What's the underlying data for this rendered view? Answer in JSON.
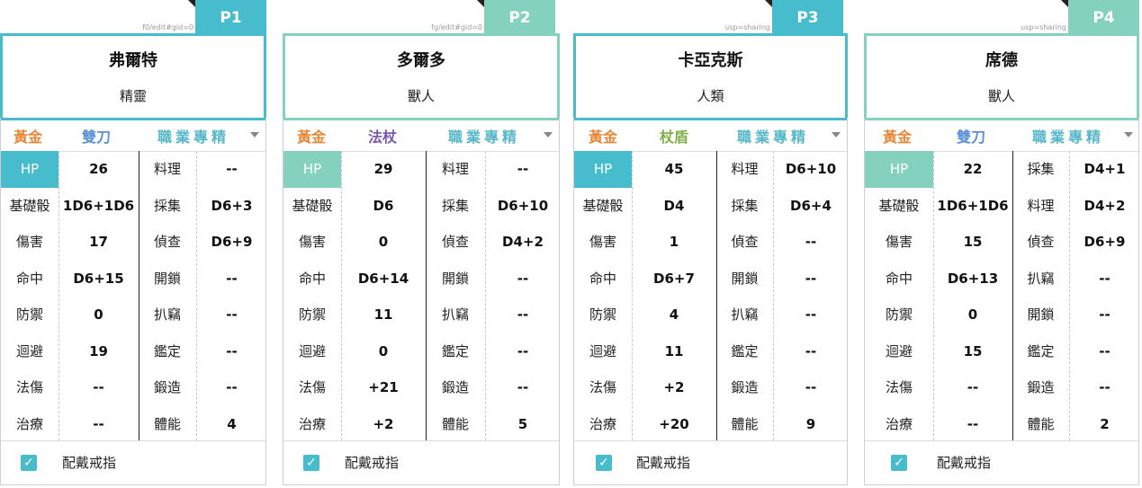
{
  "colors": {
    "teal": "#47bccd",
    "mint": "#84d1be",
    "gold": "#e8883a",
    "weapon_blue": "#5b8fd6",
    "weapon_purple": "#7b5bb0",
    "weapon_green": "#7fb04a"
  },
  "ring_label": "配戴戒指",
  "gold_label": "黃金",
  "prof_label": "職業專精",
  "stat_labels": [
    "HP",
    "基礎骰",
    "傷害",
    "命中",
    "防禦",
    "迴避",
    "法傷",
    "治療"
  ],
  "players": [
    {
      "tab": "P1",
      "url_text": "f0/edit#gid=0",
      "name": "弗爾特",
      "race": "精靈",
      "weapon": "雙刀",
      "stats": [
        "26",
        "1D6+1D6",
        "17",
        "D6+15",
        "0",
        "19",
        "--",
        "--"
      ],
      "skills": [
        [
          "料理",
          "--"
        ],
        [
          "採集",
          "D6+3"
        ],
        [
          "偵查",
          "D6+9"
        ],
        [
          "開鎖",
          "--"
        ],
        [
          "扒竊",
          "--"
        ],
        [
          "鑑定",
          "--"
        ],
        [
          "鍛造",
          "--"
        ],
        [
          "體能",
          "4"
        ]
      ],
      "ring_checked": true
    },
    {
      "tab": "P2",
      "url_text": "fg/edit#gid=0",
      "name": "多爾多",
      "race": "獸人",
      "weapon": "法杖",
      "stats": [
        "29",
        "D6",
        "0",
        "D6+14",
        "11",
        "0",
        "+21",
        "+2"
      ],
      "skills": [
        [
          "料理",
          "--"
        ],
        [
          "採集",
          "D6+10"
        ],
        [
          "偵查",
          "D4+2"
        ],
        [
          "開鎖",
          "--"
        ],
        [
          "扒竊",
          "--"
        ],
        [
          "鑑定",
          "--"
        ],
        [
          "鍛造",
          "--"
        ],
        [
          "體能",
          "5"
        ]
      ],
      "ring_checked": true
    },
    {
      "tab": "P3",
      "url_text": "usp=sharing",
      "name": "卡亞克斯",
      "race": "人類",
      "weapon": "杖盾",
      "stats": [
        "45",
        "D4",
        "1",
        "D6+7",
        "4",
        "11",
        "+2",
        "+20"
      ],
      "skills": [
        [
          "料理",
          "D6+10"
        ],
        [
          "採集",
          "D6+4"
        ],
        [
          "偵查",
          "--"
        ],
        [
          "開鎖",
          "--"
        ],
        [
          "扒竊",
          "--"
        ],
        [
          "鑑定",
          "--"
        ],
        [
          "鍛造",
          "--"
        ],
        [
          "體能",
          "9"
        ]
      ],
      "ring_checked": true
    },
    {
      "tab": "P4",
      "url_text": "usp=sharing",
      "name": "席德",
      "race": "獸人",
      "weapon": "雙刀",
      "stats": [
        "22",
        "1D6+1D6",
        "15",
        "D6+13",
        "0",
        "15",
        "--",
        "--"
      ],
      "skills": [
        [
          "採集",
          "D4+1"
        ],
        [
          "料理",
          "D4+2"
        ],
        [
          "偵查",
          "D6+9"
        ],
        [
          "扒竊",
          "--"
        ],
        [
          "開鎖",
          "--"
        ],
        [
          "鑑定",
          "--"
        ],
        [
          "鍛造",
          "--"
        ],
        [
          "體能",
          "2"
        ]
      ],
      "ring_checked": true
    }
  ]
}
